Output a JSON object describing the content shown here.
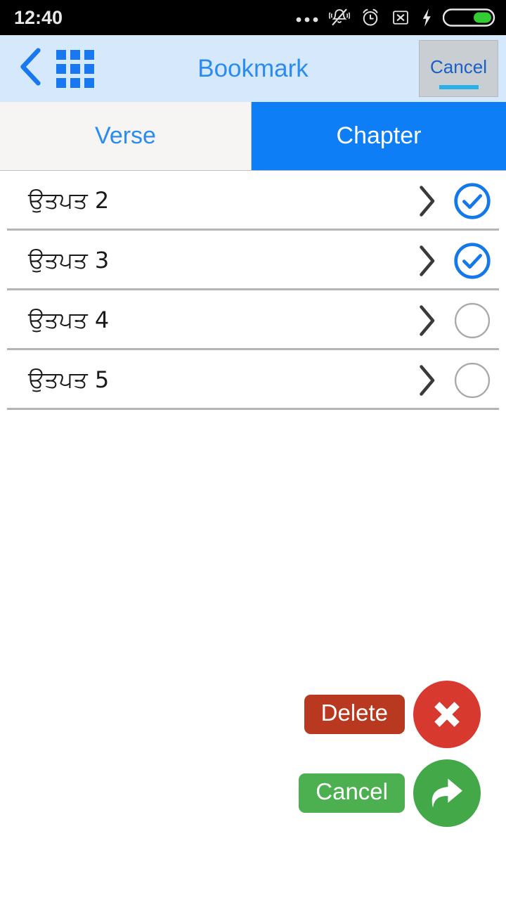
{
  "status_bar": {
    "time": "12:40",
    "icons": [
      {
        "name": "more-dots-icon",
        "glyph": "•••"
      },
      {
        "name": "silent-bell-icon",
        "glyph": "bell-muted"
      },
      {
        "name": "alarm-clock-icon",
        "glyph": "alarm"
      },
      {
        "name": "no-sim-icon",
        "glyph": "x-box"
      },
      {
        "name": "charging-bolt-icon",
        "glyph": "bolt"
      },
      {
        "name": "battery-icon",
        "glyph": "battery",
        "color": "#33cc33"
      }
    ],
    "background": "#000000",
    "text_color": "#e8e8e8"
  },
  "nav_bar": {
    "back_icon": "back-chevron-icon",
    "grid_icon": "grid-menu-icon",
    "title": "Bookmark",
    "cancel_label": "Cancel",
    "background": "#d6e8fb",
    "title_color": "#2a8cf0",
    "cancel_bg": "#c9ced2",
    "cancel_text_color": "#1c5fc4",
    "cancel_underline_color": "#2ab0e8"
  },
  "tabs": {
    "active_index": 1,
    "items": [
      {
        "label": "Verse",
        "active": false,
        "bg": "#f6f5f3",
        "color": "#2a8cf0"
      },
      {
        "label": "Chapter",
        "active": true,
        "bg": "#0d7ef5",
        "color": "#ffffff"
      }
    ]
  },
  "list": {
    "rows": [
      {
        "label": "ਉਤਪਤ 2",
        "checked": true
      },
      {
        "label": "ਉਤਪਤ 3",
        "checked": true
      },
      {
        "label": "ਉਤਪਤ 4",
        "checked": false
      },
      {
        "label": "ਉਤਪਤ 5",
        "checked": false
      }
    ],
    "chevron_icon": "chevron-right-icon",
    "checked_icon": "check-circle-icon",
    "unchecked_icon": "empty-circle-icon",
    "checked_color": "#1378ea",
    "unchecked_color": "#a9a9a9",
    "separator_color": "#b5b5b5"
  },
  "actions": {
    "delete": {
      "label": "Delete",
      "label_bg": "#b8391f",
      "icon": "close-circle-icon",
      "icon_bg": "#d8392f"
    },
    "cancel": {
      "label": "Cancel",
      "label_bg": "#4caf50",
      "icon": "share-forward-circle-icon",
      "icon_bg": "#43a847"
    }
  }
}
